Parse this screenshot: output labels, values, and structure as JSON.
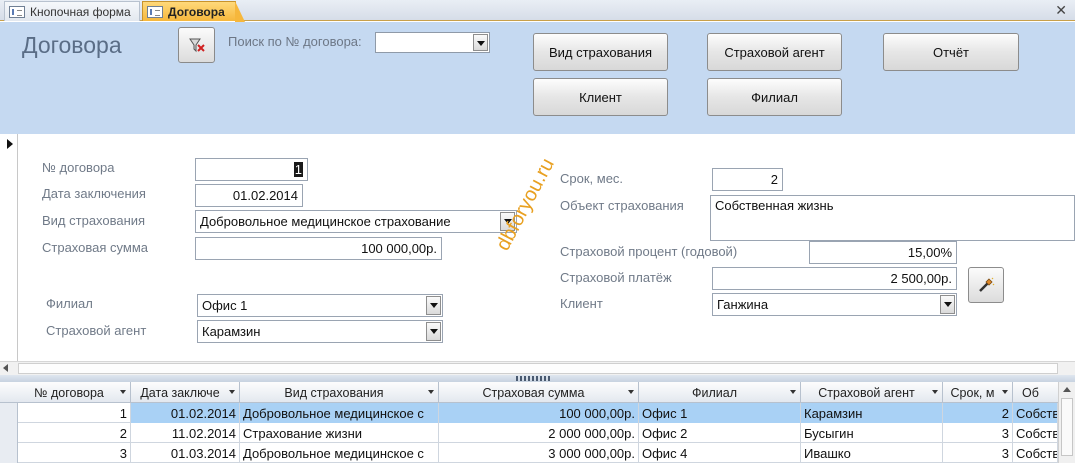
{
  "tabs": [
    {
      "label": "Кнопочная форма",
      "active": false
    },
    {
      "label": "Договора",
      "active": true
    }
  ],
  "header": {
    "title": "Договора",
    "search_label": "Поиск по № договора:",
    "search_value": "",
    "buttons": {
      "insurance_type": "Вид страхования",
      "agent": "Страховой агент",
      "report": "Отчёт",
      "client": "Клиент",
      "branch": "Филиал"
    }
  },
  "form": {
    "contract_no": {
      "label": "№ договора",
      "value": "1"
    },
    "date": {
      "label": "Дата заключения",
      "value": "01.02.2014"
    },
    "insurance_type": {
      "label": "Вид страхования",
      "value": "Добровольное медицинское страхование"
    },
    "sum": {
      "label": "Страховая сумма",
      "value": "100 000,00р."
    },
    "branch": {
      "label": "Филиал",
      "value": "Офис 1"
    },
    "agent": {
      "label": "Страховой агент",
      "value": "Карамзин"
    },
    "term": {
      "label": "Срок, мес.",
      "value": "2"
    },
    "object": {
      "label": "Объект страхования",
      "value": "Собственная жизнь"
    },
    "rate": {
      "label": "Страховой процент (годовой)",
      "value": "15,00%"
    },
    "payment": {
      "label": "Страховой платёж",
      "value": "2 500,00р."
    },
    "client": {
      "label": "Клиент",
      "value": "Ганжина"
    }
  },
  "watermark": "dbforyou.ru",
  "grid": {
    "columns": [
      "№ договора",
      "Дата заключе",
      "Вид страхования",
      "Страховая сумма",
      "Филиал",
      "Страховой агент",
      "Срок, м",
      "Об"
    ],
    "rows": [
      [
        "1",
        "01.02.2014",
        "Добровольное медицинское с",
        "100 000,00р.",
        "Офис 1",
        "Карамзин",
        "2",
        "Собств"
      ],
      [
        "2",
        "11.02.2014",
        "Страхование жизни",
        "2 000 000,00р.",
        "Офис 2",
        "Бусыгин",
        "3",
        "Собств"
      ],
      [
        "3",
        "01.03.2014",
        "Добровольное медицинское с",
        "3 000 000,00р.",
        "Офис 4",
        "Ивашко",
        "3",
        "Собств"
      ]
    ]
  },
  "colors": {
    "header_bg": "#c5d9f1",
    "active_tab": "#f6b73c",
    "row_highlight": "#a9d1f5"
  }
}
